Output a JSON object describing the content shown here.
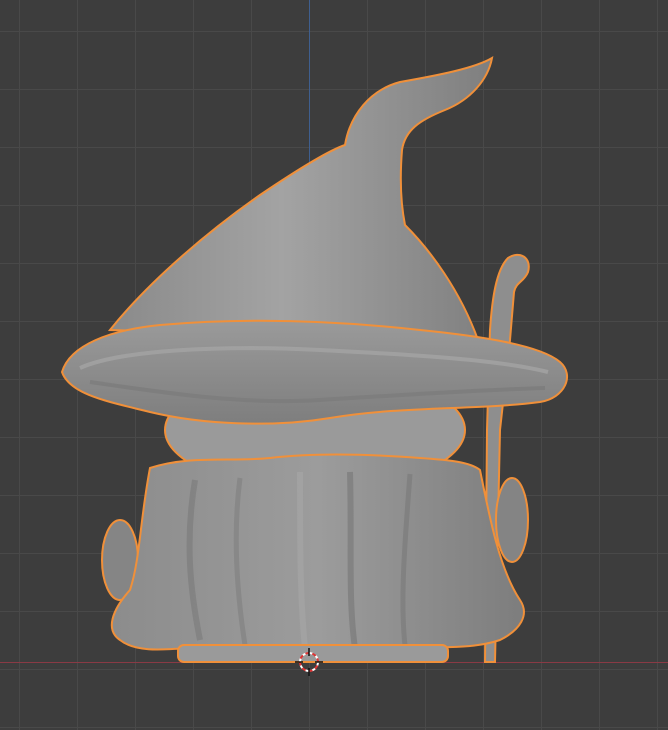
{
  "viewport": {
    "view": "front-orthographic",
    "object": "wizard-sculpt",
    "selected": true,
    "colors": {
      "background": "#3d3d3d",
      "grid": "#494949",
      "x_axis": "#8a3a45",
      "z_axis": "#3f5f8f",
      "selection_outline": "#f0903a",
      "mesh": "#8f8f8f"
    },
    "icons": [
      "3d-cursor-icon"
    ]
  }
}
